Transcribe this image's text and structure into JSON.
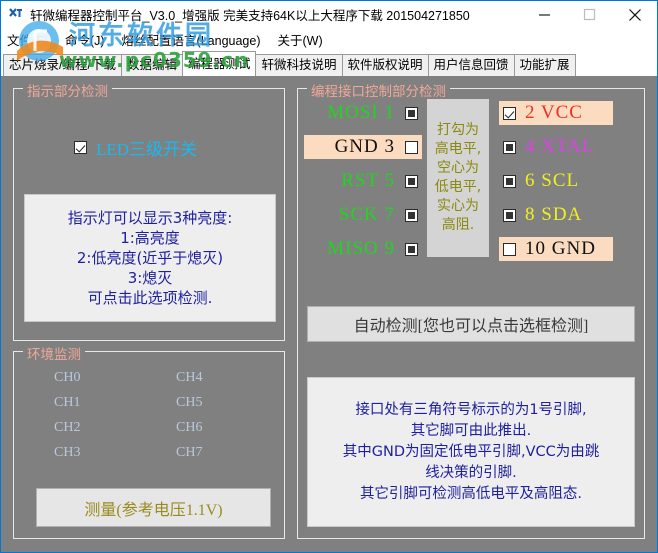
{
  "window": {
    "title": "轩微编程器控制平台_V3.0_增强版 完美支持64K以上大程序下载 201504271850",
    "minimize": "—",
    "maximize": "□",
    "close": "✕"
  },
  "menu": {
    "items": [
      {
        "label": "文件(F)"
      },
      {
        "label": "命令(J)"
      },
      {
        "label": "熔丝配置语言(Language)"
      },
      {
        "label": "关于(W)"
      }
    ]
  },
  "tabs": [
    {
      "label": "芯片烧录/编程/下载",
      "active": false
    },
    {
      "label": "数据编辑",
      "active": false
    },
    {
      "label": "编程器测试",
      "active": true
    },
    {
      "label": "轩微科技说明",
      "active": false
    },
    {
      "label": "软件版权说明",
      "active": false
    },
    {
      "label": "用户信息回馈",
      "active": false
    },
    {
      "label": "功能扩展",
      "active": false
    }
  ],
  "indicator_group": {
    "title": "指示部分检测",
    "led_checkbox_label": "LED三级开关",
    "led_checkbox_checked": true,
    "info_lines": [
      "指示灯可以显示3种亮度:",
      "1:高亮度",
      "2:低亮度(近乎于熄灭)",
      "3:熄灭",
      "可点击此选项检测."
    ]
  },
  "env_group": {
    "title": "环境监测",
    "channels_left": [
      "CH0",
      "CH1",
      "CH2",
      "CH3"
    ],
    "channels_right": [
      "CH4",
      "CH5",
      "CH6",
      "CH7"
    ],
    "measure_button": "测量(参考电压1.1V)"
  },
  "prog_group": {
    "title": "编程接口控制部分检测",
    "pins_left": [
      {
        "label": "MOSI 1",
        "state": "solid",
        "highlight": false,
        "color": "#22d422"
      },
      {
        "label": "GND 3",
        "state": "empty",
        "highlight": true,
        "color": "#101010"
      },
      {
        "label": "RST 5",
        "state": "solid",
        "highlight": false,
        "color": "#22d422"
      },
      {
        "label": "SCK 7",
        "state": "solid",
        "highlight": false,
        "color": "#22d422"
      },
      {
        "label": "MISO 9",
        "state": "solid",
        "highlight": false,
        "color": "#22d422"
      }
    ],
    "pins_right": [
      {
        "label": "2  VCC",
        "state": "checked",
        "highlight": true,
        "color": "#f03020"
      },
      {
        "label": "4  XTAL",
        "state": "solid",
        "highlight": false,
        "color": "#e040e8"
      },
      {
        "label": "6  SCL",
        "state": "solid",
        "highlight": false,
        "color": "#f0f020"
      },
      {
        "label": "8  SDA",
        "state": "solid",
        "highlight": false,
        "color": "#f0f020"
      },
      {
        "label": "10 GND",
        "state": "empty",
        "highlight": true,
        "color": "#101010"
      }
    ],
    "note_lines": [
      "打勾为",
      "高电平,",
      "空心为",
      "低电平,",
      "实心为",
      "高阻."
    ],
    "auto_button": "自动检测[您也可以点击选框检测]",
    "info_lines": [
      "接口处有三角符号标示的为1号引脚,",
      "其它脚可由此推出.",
      "其中GND为固定低电平引脚,VCC为由跳",
      "线决策的引脚.",
      "其它引脚可检测高低电平及高阻态."
    ]
  },
  "watermark": {
    "site_cn": "河东软件园",
    "site_url": "www.pc0359.cn"
  },
  "colors": {
    "window_bg": "#808080",
    "group_title": "#f0a898",
    "accent_blue": "#0078d7",
    "highlight_bg": "#fbdcc0",
    "info_text": "#1f1fa0",
    "note_text": "#8a8a10"
  }
}
